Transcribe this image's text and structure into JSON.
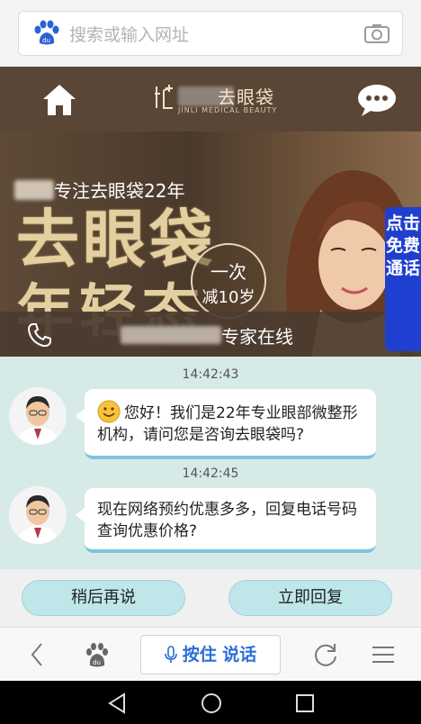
{
  "search": {
    "placeholder": "搜索或输入网址"
  },
  "header": {
    "brand_name": "去眼袋",
    "brand_subtitle": "JINLI MEDICAL BEAUTY"
  },
  "banner": {
    "tagline": "专注去眼袋22年",
    "headline": "去眼袋",
    "subline": "年轻态",
    "promo_line1": "一次",
    "promo_line2": "减10岁"
  },
  "free_call": {
    "label": "点击免费通话"
  },
  "expert_bar": {
    "label": "专家在线"
  },
  "chat": {
    "messages": [
      {
        "time": "14:42:43",
        "text": "您好！我们是22年专业眼部微整形机构，请问您是咨询去眼袋吗?"
      },
      {
        "time": "14:42:45",
        "text": "现在网络预约优惠多多，回复电话号码查询优惠价格?"
      }
    ]
  },
  "reply": {
    "later": "稍后再说",
    "now": "立即回复"
  },
  "toolbar": {
    "voice": "按住 说话"
  },
  "colors": {
    "header_bg": "#5a4637",
    "free_call_bg": "#1f3fd0",
    "chat_bg": "#d6eae8",
    "reply_btn": "#bfe7ea",
    "voice_blue": "#2a6fd6"
  },
  "icons": [
    "baidu-paw-icon",
    "camera-icon",
    "home-icon",
    "chat-bubble-icon",
    "phone-icon",
    "smile-icon",
    "back-icon",
    "paw-icon",
    "mic-icon",
    "refresh-icon",
    "menu-icon",
    "nav-back-icon",
    "nav-home-icon",
    "nav-recents-icon"
  ]
}
